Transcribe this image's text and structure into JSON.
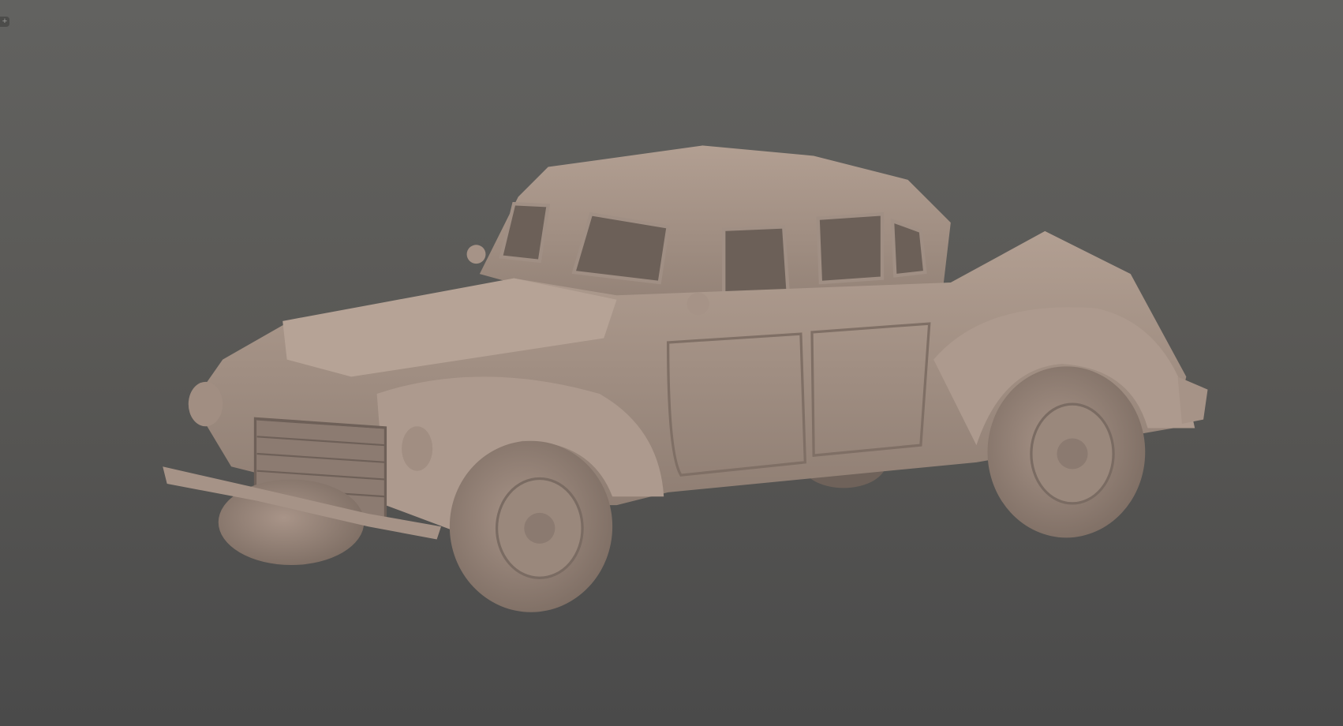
{
  "viewport": {
    "expand_icon": "plus-icon",
    "model_icon": "car-3d-model",
    "colors": {
      "background_top": "#626260",
      "background_bottom": "#4a4a4a",
      "model_base": "#a8968a"
    }
  }
}
